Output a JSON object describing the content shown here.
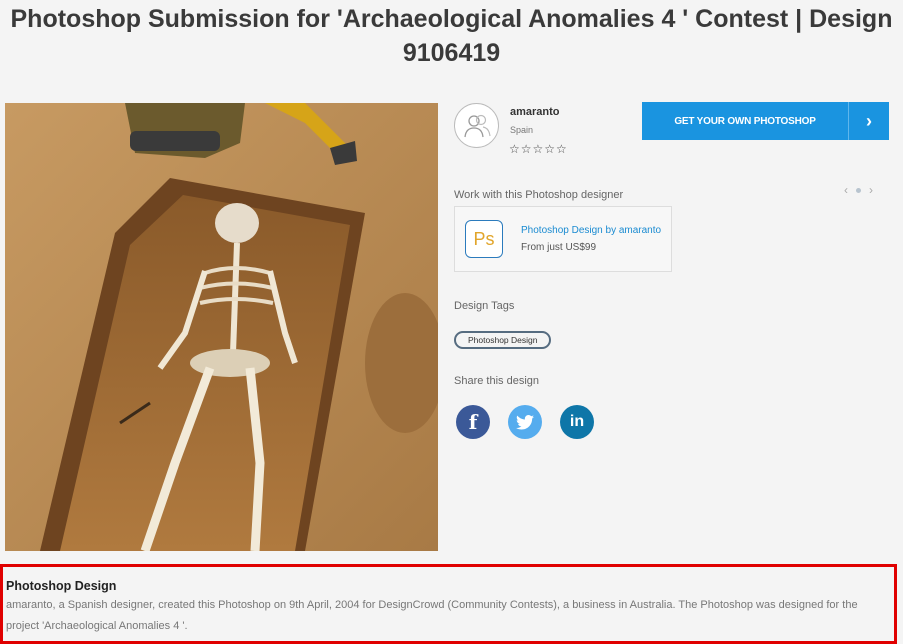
{
  "page": {
    "title": "Photoshop Submission for 'Archaeological Anomalies 4 ' Contest | Design 9106419"
  },
  "designer": {
    "name": "amaranto",
    "country": "Spain",
    "rating_stars": "☆☆☆☆☆",
    "rating_value": 0,
    "rating_max": 5
  },
  "cta": {
    "label": "GET YOUR OWN PHOTOSHOP",
    "arrow_icon": "chevron-right-icon"
  },
  "work_section": {
    "label": "Work with this Photoshop designer",
    "card": {
      "icon_text": "Ps",
      "title": "Photoshop Design by amaranto",
      "price": "From just US$99"
    }
  },
  "tags_section": {
    "label": "Design Tags",
    "tags": [
      "Photoshop Design"
    ]
  },
  "share_section": {
    "label": "Share this design",
    "buttons": [
      {
        "icon": "facebook-icon",
        "glyph": "f",
        "color": "#3b5998"
      },
      {
        "icon": "twitter-icon",
        "glyph": "t",
        "color": "#55acee"
      },
      {
        "icon": "linkedin-icon",
        "glyph": "in",
        "color": "#0e76a8"
      }
    ]
  },
  "description": {
    "title": "Photoshop Design",
    "text": "amaranto, a Spanish designer, created this Photoshop on 9th April, 2004 for DesignCrowd (Community Contests), a business in Australia. The Photoshop was designed for the project 'Archaeological Anomalies 4 '."
  },
  "colors": {
    "accent": "#1a94e0",
    "highlight_border": "#e00000",
    "link": "#1a8bd1"
  }
}
